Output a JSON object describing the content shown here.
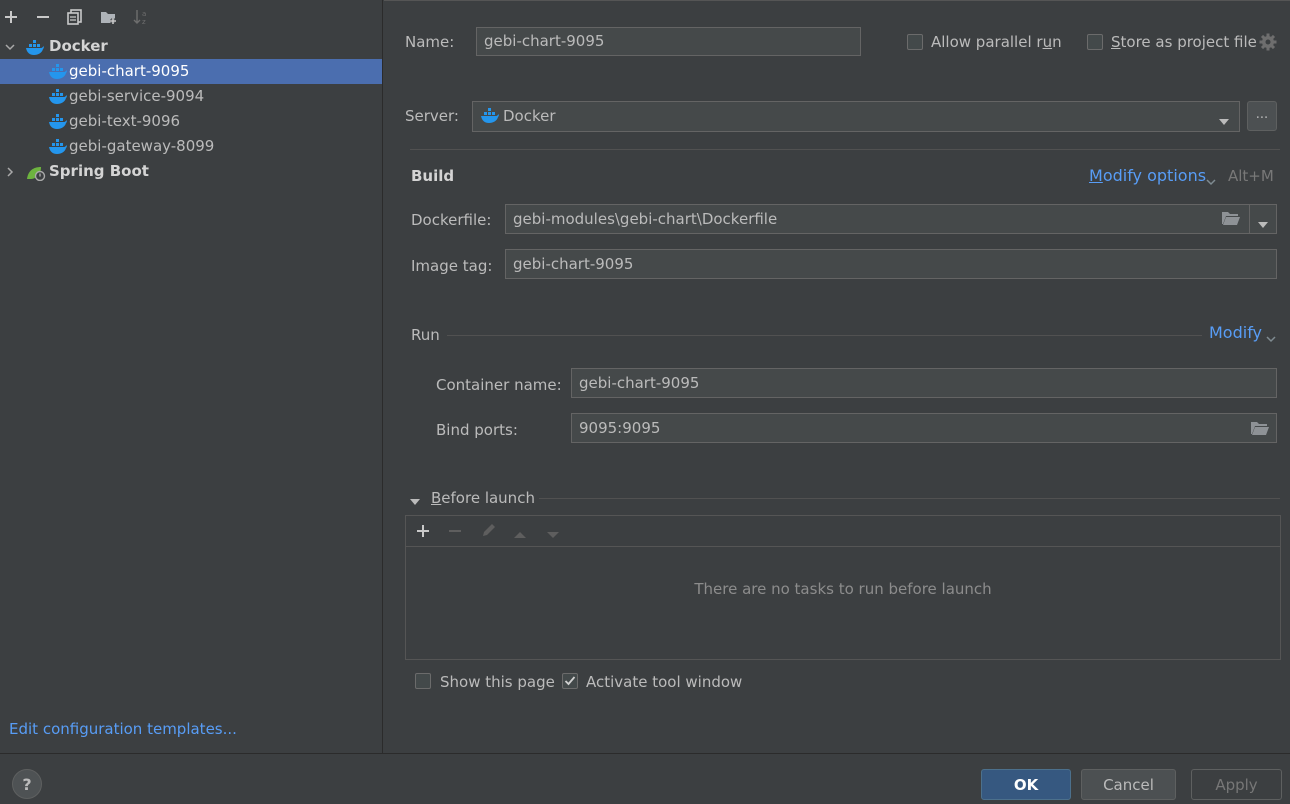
{
  "sidebar": {
    "toolbar": [
      "add-icon",
      "remove-icon",
      "copy-icon",
      "folder-add-icon",
      "sort-icon"
    ],
    "tree": [
      {
        "label": "Docker",
        "bold": true
      },
      {
        "label": "gebi-chart-9095",
        "selected": true
      },
      {
        "label": "gebi-service-9094"
      },
      {
        "label": "gebi-text-9096"
      },
      {
        "label": "gebi-gateway-8099"
      },
      {
        "label": "Spring Boot",
        "bold": true
      }
    ],
    "edit_templates": "Edit configuration templates..."
  },
  "form": {
    "name_label": "Name:",
    "name_value": "gebi-chart-9095",
    "allow_parallel_prefix": "Allow parallel r",
    "allow_parallel_u": "u",
    "allow_parallel_suffix": "n",
    "store_project_u": "S",
    "store_project_suffix": "tore as project file",
    "server_label": "Server:",
    "server_value": "Docker",
    "ellipsis": "...",
    "build_title": "Build",
    "modify_options_u": "M",
    "modify_options_rest": "odify options",
    "modify_options_shortcut": "Alt+M",
    "dockerfile_label": "Dockerfile:",
    "dockerfile_value": "gebi-modules\\gebi-chart\\Dockerfile",
    "image_tag_label": "Image tag:",
    "image_tag_value": "gebi-chart-9095",
    "run_title": "Run",
    "run_modify": "Modify",
    "container_name_label": "Container name:",
    "container_name_value": "gebi-chart-9095",
    "bind_ports_label": "Bind ports:",
    "bind_ports_value": "9095:9095",
    "before_launch_u": "B",
    "before_launch_rest": "efore launch",
    "before_launch_empty": "There are no tasks to run before launch",
    "show_page_label": "Show this page",
    "activate_tool_label": "Activate tool window",
    "show_page_checked": false,
    "activate_tool_checked": true
  },
  "footer": {
    "help": "?",
    "ok": "OK",
    "cancel": "Cancel",
    "apply": "Apply"
  },
  "colors": {
    "background": "#3c3f41",
    "selection": "#4b6eaf",
    "link": "#589df6",
    "ok_button": "#365880",
    "docker_blue": "#2496ed",
    "spring_green": "#6db33f"
  }
}
